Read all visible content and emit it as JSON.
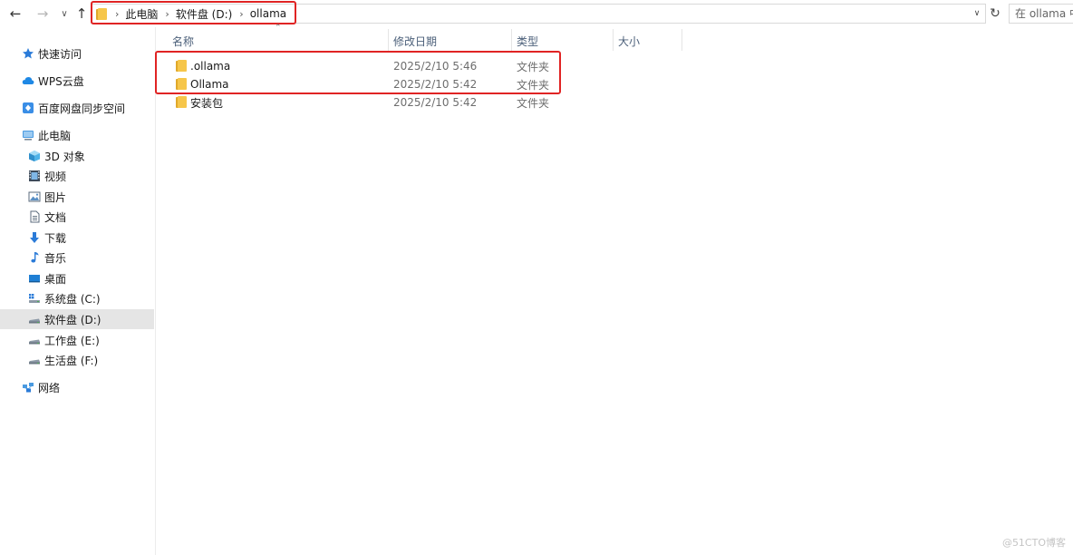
{
  "navigation": {
    "back_icon": "arrow-left-icon",
    "forward_icon": "arrow-right-icon",
    "recent_icon": "chevron-down-icon",
    "up_icon": "arrow-up-icon",
    "refresh_icon": "refresh-icon"
  },
  "address_bar": {
    "crumbs": [
      "此电脑",
      "软件盘 (D:)",
      "ollama"
    ],
    "highlight_color": "#e02424"
  },
  "search": {
    "placeholder": "在 ollama 中搜索"
  },
  "sidebar": {
    "items": [
      {
        "label": "快速访问",
        "icon": "star-icon"
      },
      {
        "label": "WPS云盘",
        "icon": "cloud-icon"
      },
      {
        "label": "百度网盘同步空间",
        "icon": "baidu-sync-icon"
      },
      {
        "label": "此电脑",
        "icon": "computer-icon"
      },
      {
        "label": "3D 对象",
        "icon": "cube-icon"
      },
      {
        "label": "视频",
        "icon": "film-icon"
      },
      {
        "label": "图片",
        "icon": "picture-icon"
      },
      {
        "label": "文档",
        "icon": "document-icon"
      },
      {
        "label": "下载",
        "icon": "download-icon"
      },
      {
        "label": "音乐",
        "icon": "music-icon"
      },
      {
        "label": "桌面",
        "icon": "desktop-icon"
      },
      {
        "label": "系统盘 (C:)",
        "icon": "system-drive-icon"
      },
      {
        "label": "软件盘 (D:)",
        "icon": "drive-icon",
        "selected": true
      },
      {
        "label": "工作盘 (E:)",
        "icon": "drive-icon"
      },
      {
        "label": "生活盘 (F:)",
        "icon": "drive-icon"
      },
      {
        "label": "网络",
        "icon": "network-icon"
      }
    ]
  },
  "columns": {
    "name": "名称",
    "date": "修改日期",
    "type": "类型",
    "size": "大小",
    "sort_icon": "sort-up-icon"
  },
  "files": [
    {
      "name": ".ollama",
      "date": "2025/2/10 5:46",
      "type": "文件夹",
      "icon": "folder-icon",
      "highlighted": true
    },
    {
      "name": "Ollama",
      "date": "2025/2/10 5:42",
      "type": "文件夹",
      "icon": "folder-icon",
      "highlighted": true
    },
    {
      "name": "安装包",
      "date": "2025/2/10 5:42",
      "type": "文件夹",
      "icon": "folder-icon",
      "highlighted": false
    }
  ],
  "watermark": "@51CTO博客",
  "colors": {
    "folder": "#f6c64a",
    "folder_dark": "#e0a82a",
    "selected_bg": "#e5e5e5",
    "highlight": "#e02424",
    "accent_blue": "#1e88e5"
  }
}
